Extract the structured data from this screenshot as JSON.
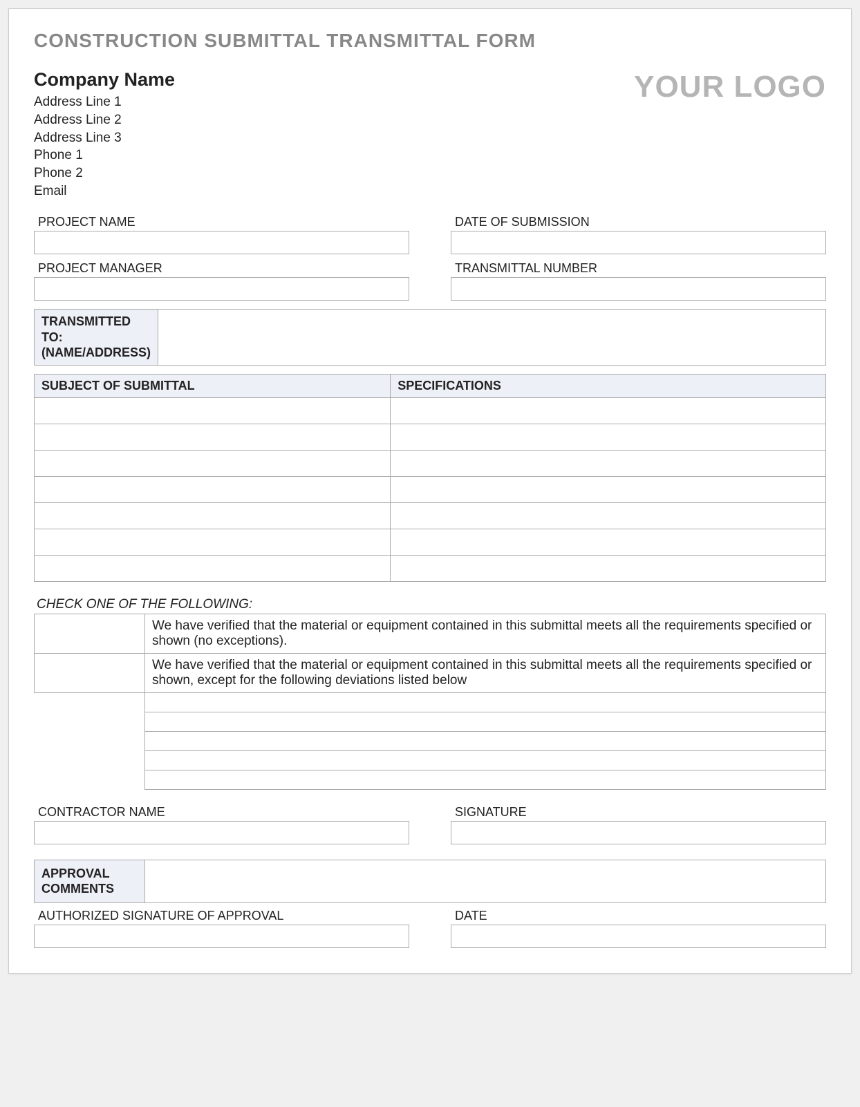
{
  "title": "CONSTRUCTION SUBMITTAL TRANSMITTAL FORM",
  "company": {
    "name": "Company Name",
    "address1": "Address Line 1",
    "address2": "Address Line 2",
    "address3": "Address Line 3",
    "phone1": "Phone 1",
    "phone2": "Phone 2",
    "email": "Email"
  },
  "logo_text": "YOUR LOGO",
  "fields": {
    "project_name": {
      "label": "PROJECT NAME",
      "value": ""
    },
    "date_of_submission": {
      "label": "DATE OF SUBMISSION",
      "value": ""
    },
    "project_manager": {
      "label": "PROJECT MANAGER",
      "value": ""
    },
    "transmittal_number": {
      "label": "TRANSMITTAL NUMBER",
      "value": ""
    },
    "contractor_name": {
      "label": "CONTRACTOR NAME",
      "value": ""
    },
    "signature": {
      "label": "SIGNATURE",
      "value": ""
    },
    "authorized_signature": {
      "label": "AUTHORIZED SIGNATURE OF APPROVAL",
      "value": ""
    },
    "date": {
      "label": "DATE",
      "value": ""
    }
  },
  "transmitted_to_label": "TRANSMITTED TO: (NAME/ADDRESS)",
  "subject_table": {
    "headers": {
      "subject": "SUBJECT OF SUBMITTAL",
      "specs": "SPECIFICATIONS"
    },
    "rows": [
      {
        "subject": "",
        "specs": ""
      },
      {
        "subject": "",
        "specs": ""
      },
      {
        "subject": "",
        "specs": ""
      },
      {
        "subject": "",
        "specs": ""
      },
      {
        "subject": "",
        "specs": ""
      },
      {
        "subject": "",
        "specs": ""
      },
      {
        "subject": "",
        "specs": ""
      }
    ]
  },
  "check_section": {
    "header": "CHECK ONE OF THE FOLLOWING:",
    "option1": "We have verified that the material or equipment contained in this submittal meets all the requirements specified or shown (no exceptions).",
    "option2": "We have verified that the material or equipment contained in this submittal meets all the requirements specified or shown, except for the following deviations listed below",
    "deviation_lines": [
      "",
      "",
      "",
      "",
      ""
    ]
  },
  "approval_label": "APPROVAL COMMENTS"
}
